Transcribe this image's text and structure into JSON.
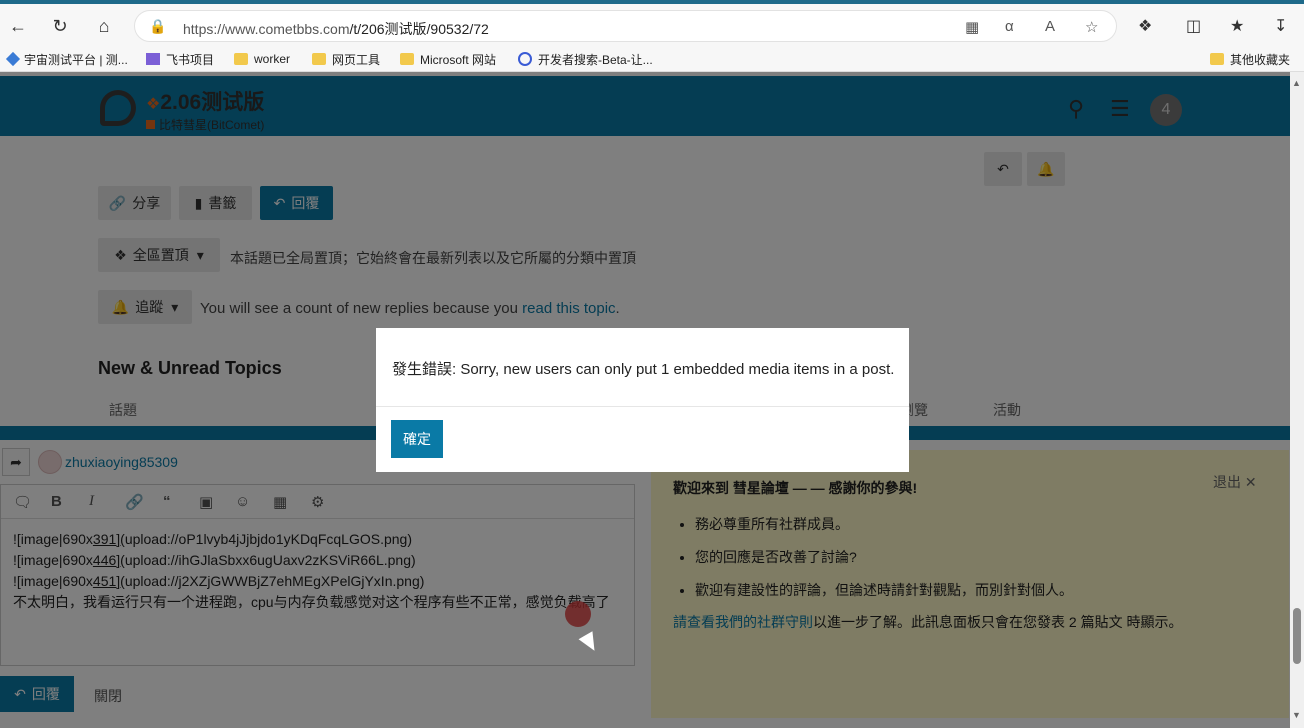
{
  "browser": {
    "url_prefix": "https://www.cometbbs.com",
    "url_path": "/t/206测试版/90532/72",
    "bookmarks": [
      {
        "label": "宇宙测试平台 | 测..."
      },
      {
        "label": "飞书项目"
      },
      {
        "label": "worker"
      },
      {
        "label": "网页工具"
      },
      {
        "label": "Microsoft 网站"
      },
      {
        "label": "开发者搜索-Beta-让..."
      }
    ],
    "other_bookmarks": "其他收藏夹"
  },
  "site": {
    "title": "2.06测试版",
    "subtitle": "比特彗星(BitComet)",
    "notification_count": "4"
  },
  "topic_controls": {
    "share": "分享",
    "bookmark": "書籤",
    "reply": "回覆",
    "pinned_label": "全區置頂",
    "pinned_note": "本話題已全局置頂；它始終會在最新列表以及它所屬的分類中置頂",
    "tracking_label": "追蹤",
    "tracking_note_pre": "You will see a count of new replies because you",
    "tracking_note_link": "read this topic",
    "tracking_note_post": "."
  },
  "suggested": {
    "heading": "New & Unread Topics",
    "col_topic": "話題",
    "col_views": "瀏覽",
    "col_activity": "活動"
  },
  "composer": {
    "username": "zhuxiaoying85309",
    "lines": [
      {
        "a": "![image|690x",
        "b": "391](",
        "c": "upload://oP1lvyb4jJjbjdo1yKDqFcqLGOS.png)"
      },
      {
        "a": "![image|690x",
        "b": "446](",
        "c": "upload://ihGJlaSbxx6ugUaxv2zKSViR66L.png)"
      },
      {
        "a": "![image|690x",
        "b": "451](",
        "c": "upload://j2XZjGWWBjZ7ehMEgXPelGjYxIn.png)"
      }
    ],
    "text": "不太明白，我看运行只有一个进程跑，cpu与内存负载感觉对这个程序有些不正常，感觉负载高了",
    "reply_button": "回覆",
    "close_button": "關閉"
  },
  "tips": {
    "title": "歡迎來到 彗星論壇 — — 感謝你的參與!",
    "exit": "退出",
    "items": [
      "務必尊重所有社群成員。",
      "您的回應是否改善了討論?",
      "歡迎有建設性的評論，但論述時請針對觀點，而別針對個人。"
    ],
    "foot_link": "請查看我們的社群守則",
    "foot_text": "以進一步了解。此訊息面板只會在您發表 2 篇貼文 時顯示。"
  },
  "modal": {
    "message": "發生錯誤: Sorry, new users can only put 1 embedded media items in a post.",
    "ok": "確定"
  },
  "colors": {
    "brand": "#0a7aa6",
    "tip_bg": "#fff9c9",
    "overlay": "rgba(0,0,0,0.5)"
  }
}
